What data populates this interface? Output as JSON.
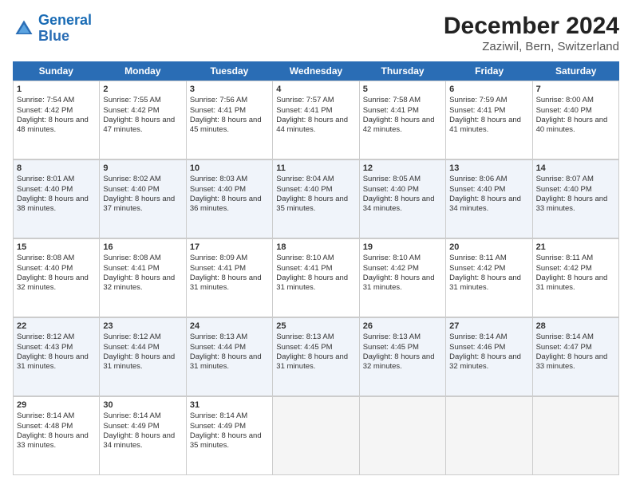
{
  "logo": {
    "line1": "General",
    "line2": "Blue"
  },
  "title": "December 2024",
  "subtitle": "Zaziwil, Bern, Switzerland",
  "header_days": [
    "Sunday",
    "Monday",
    "Tuesday",
    "Wednesday",
    "Thursday",
    "Friday",
    "Saturday"
  ],
  "weeks": [
    [
      {
        "day": 1,
        "sunrise": "Sunrise: 7:54 AM",
        "sunset": "Sunset: 4:42 PM",
        "daylight": "Daylight: 8 hours and 48 minutes."
      },
      {
        "day": 2,
        "sunrise": "Sunrise: 7:55 AM",
        "sunset": "Sunset: 4:42 PM",
        "daylight": "Daylight: 8 hours and 47 minutes."
      },
      {
        "day": 3,
        "sunrise": "Sunrise: 7:56 AM",
        "sunset": "Sunset: 4:41 PM",
        "daylight": "Daylight: 8 hours and 45 minutes."
      },
      {
        "day": 4,
        "sunrise": "Sunrise: 7:57 AM",
        "sunset": "Sunset: 4:41 PM",
        "daylight": "Daylight: 8 hours and 44 minutes."
      },
      {
        "day": 5,
        "sunrise": "Sunrise: 7:58 AM",
        "sunset": "Sunset: 4:41 PM",
        "daylight": "Daylight: 8 hours and 42 minutes."
      },
      {
        "day": 6,
        "sunrise": "Sunrise: 7:59 AM",
        "sunset": "Sunset: 4:41 PM",
        "daylight": "Daylight: 8 hours and 41 minutes."
      },
      {
        "day": 7,
        "sunrise": "Sunrise: 8:00 AM",
        "sunset": "Sunset: 4:40 PM",
        "daylight": "Daylight: 8 hours and 40 minutes."
      }
    ],
    [
      {
        "day": 8,
        "sunrise": "Sunrise: 8:01 AM",
        "sunset": "Sunset: 4:40 PM",
        "daylight": "Daylight: 8 hours and 38 minutes."
      },
      {
        "day": 9,
        "sunrise": "Sunrise: 8:02 AM",
        "sunset": "Sunset: 4:40 PM",
        "daylight": "Daylight: 8 hours and 37 minutes."
      },
      {
        "day": 10,
        "sunrise": "Sunrise: 8:03 AM",
        "sunset": "Sunset: 4:40 PM",
        "daylight": "Daylight: 8 hours and 36 minutes."
      },
      {
        "day": 11,
        "sunrise": "Sunrise: 8:04 AM",
        "sunset": "Sunset: 4:40 PM",
        "daylight": "Daylight: 8 hours and 35 minutes."
      },
      {
        "day": 12,
        "sunrise": "Sunrise: 8:05 AM",
        "sunset": "Sunset: 4:40 PM",
        "daylight": "Daylight: 8 hours and 34 minutes."
      },
      {
        "day": 13,
        "sunrise": "Sunrise: 8:06 AM",
        "sunset": "Sunset: 4:40 PM",
        "daylight": "Daylight: 8 hours and 34 minutes."
      },
      {
        "day": 14,
        "sunrise": "Sunrise: 8:07 AM",
        "sunset": "Sunset: 4:40 PM",
        "daylight": "Daylight: 8 hours and 33 minutes."
      }
    ],
    [
      {
        "day": 15,
        "sunrise": "Sunrise: 8:08 AM",
        "sunset": "Sunset: 4:40 PM",
        "daylight": "Daylight: 8 hours and 32 minutes."
      },
      {
        "day": 16,
        "sunrise": "Sunrise: 8:08 AM",
        "sunset": "Sunset: 4:41 PM",
        "daylight": "Daylight: 8 hours and 32 minutes."
      },
      {
        "day": 17,
        "sunrise": "Sunrise: 8:09 AM",
        "sunset": "Sunset: 4:41 PM",
        "daylight": "Daylight: 8 hours and 31 minutes."
      },
      {
        "day": 18,
        "sunrise": "Sunrise: 8:10 AM",
        "sunset": "Sunset: 4:41 PM",
        "daylight": "Daylight: 8 hours and 31 minutes."
      },
      {
        "day": 19,
        "sunrise": "Sunrise: 8:10 AM",
        "sunset": "Sunset: 4:42 PM",
        "daylight": "Daylight: 8 hours and 31 minutes."
      },
      {
        "day": 20,
        "sunrise": "Sunrise: 8:11 AM",
        "sunset": "Sunset: 4:42 PM",
        "daylight": "Daylight: 8 hours and 31 minutes."
      },
      {
        "day": 21,
        "sunrise": "Sunrise: 8:11 AM",
        "sunset": "Sunset: 4:42 PM",
        "daylight": "Daylight: 8 hours and 31 minutes."
      }
    ],
    [
      {
        "day": 22,
        "sunrise": "Sunrise: 8:12 AM",
        "sunset": "Sunset: 4:43 PM",
        "daylight": "Daylight: 8 hours and 31 minutes."
      },
      {
        "day": 23,
        "sunrise": "Sunrise: 8:12 AM",
        "sunset": "Sunset: 4:44 PM",
        "daylight": "Daylight: 8 hours and 31 minutes."
      },
      {
        "day": 24,
        "sunrise": "Sunrise: 8:13 AM",
        "sunset": "Sunset: 4:44 PM",
        "daylight": "Daylight: 8 hours and 31 minutes."
      },
      {
        "day": 25,
        "sunrise": "Sunrise: 8:13 AM",
        "sunset": "Sunset: 4:45 PM",
        "daylight": "Daylight: 8 hours and 31 minutes."
      },
      {
        "day": 26,
        "sunrise": "Sunrise: 8:13 AM",
        "sunset": "Sunset: 4:45 PM",
        "daylight": "Daylight: 8 hours and 32 minutes."
      },
      {
        "day": 27,
        "sunrise": "Sunrise: 8:14 AM",
        "sunset": "Sunset: 4:46 PM",
        "daylight": "Daylight: 8 hours and 32 minutes."
      },
      {
        "day": 28,
        "sunrise": "Sunrise: 8:14 AM",
        "sunset": "Sunset: 4:47 PM",
        "daylight": "Daylight: 8 hours and 33 minutes."
      }
    ],
    [
      {
        "day": 29,
        "sunrise": "Sunrise: 8:14 AM",
        "sunset": "Sunset: 4:48 PM",
        "daylight": "Daylight: 8 hours and 33 minutes."
      },
      {
        "day": 30,
        "sunrise": "Sunrise: 8:14 AM",
        "sunset": "Sunset: 4:49 PM",
        "daylight": "Daylight: 8 hours and 34 minutes."
      },
      {
        "day": 31,
        "sunrise": "Sunrise: 8:14 AM",
        "sunset": "Sunset: 4:49 PM",
        "daylight": "Daylight: 8 hours and 35 minutes."
      },
      null,
      null,
      null,
      null
    ]
  ]
}
